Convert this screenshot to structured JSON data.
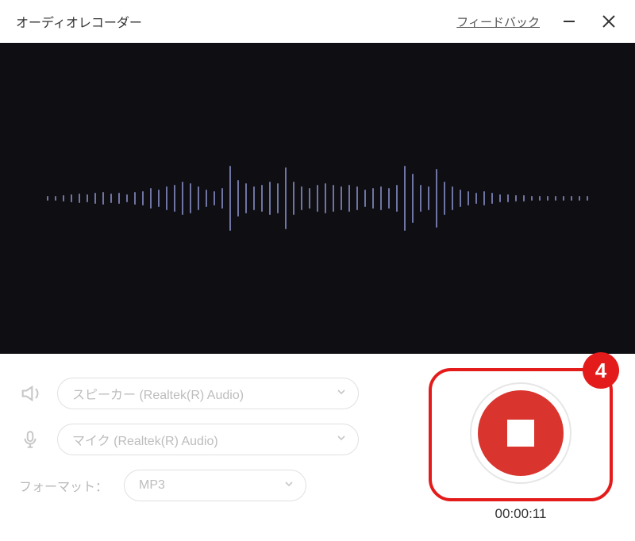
{
  "titlebar": {
    "title": "オーディオレコーダー",
    "feedback": "フィードバック"
  },
  "speaker": {
    "value": "スピーカー (Realtek(R) Audio)"
  },
  "mic": {
    "value": "マイク (Realtek(R) Audio)"
  },
  "format": {
    "label": "フォーマット：",
    "value": "MP3"
  },
  "timer": "00:00:11",
  "callout_number": "4"
}
